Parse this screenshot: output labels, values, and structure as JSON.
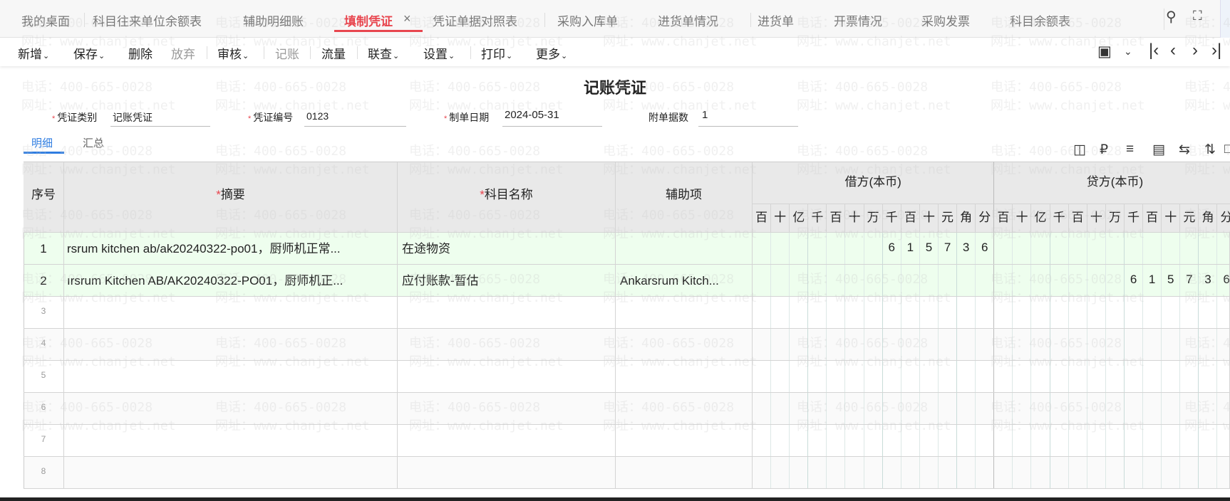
{
  "tabs": [
    {
      "label": "我的桌面"
    },
    {
      "label": "科目往来单位余额表"
    },
    {
      "label": "辅助明细账"
    },
    {
      "label": "填制凭证",
      "active": true
    },
    {
      "label": "凭证单据对照表"
    },
    {
      "label": "采购入库单"
    },
    {
      "label": "进货单情况"
    },
    {
      "label": "进货单"
    },
    {
      "label": "开票情况"
    },
    {
      "label": "采购发票"
    },
    {
      "label": "科目余额表"
    }
  ],
  "tab_close": "×",
  "toolbar": {
    "add": "新增",
    "save": "保存",
    "delete": "删除",
    "discard": "放弃",
    "review": "审核",
    "post": "记账",
    "flow": "流量",
    "linked": "联查",
    "settings": "设置",
    "print": "打印",
    "more": "更多"
  },
  "title": "记账凭证",
  "form": {
    "type_label": "凭证类别",
    "type_value": "记账凭证",
    "no_label": "凭证编号",
    "no_value": "0123",
    "date_label": "制单日期",
    "date_value": "2024-05-31",
    "attach_label": "附单据数",
    "attach_value": "1"
  },
  "subtabs": [
    "明细",
    "汇总"
  ],
  "table": {
    "h_no": "序号",
    "h_summary": "摘要",
    "h_account": "科目名称",
    "h_aux": "辅助项",
    "h_debit": "借方(本币)",
    "h_credit": "贷方(本币)",
    "units": [
      "百",
      "十",
      "亿",
      "千",
      "百",
      "十",
      "万",
      "千",
      "百",
      "十",
      "元",
      "角",
      "分"
    ],
    "rows": [
      {
        "no": "1",
        "summary": "rsrum kitchen ab/ak20240322-po01，厨师机正常...",
        "account": "在途物资",
        "aux": "",
        "debit": "615736",
        "credit": ""
      },
      {
        "no": "2",
        "summary": "ırsrum Kitchen AB/AK20240322-PO01，厨师机正...",
        "account": "应付账款-暂估",
        "aux": "Ankarsrum Kitch...",
        "debit": "",
        "credit": "615736"
      },
      {
        "no": "3"
      },
      {
        "no": "4"
      },
      {
        "no": "5"
      },
      {
        "no": "6"
      },
      {
        "no": "7"
      },
      {
        "no": "8"
      }
    ]
  },
  "watermark": {
    "phone": "电话：400-665-0028",
    "site": "网址：www.chanjet.net"
  },
  "colors": {
    "accent": "#e8464f",
    "tab_blue": "#2f7de1",
    "row_fill": "#eefeee"
  }
}
